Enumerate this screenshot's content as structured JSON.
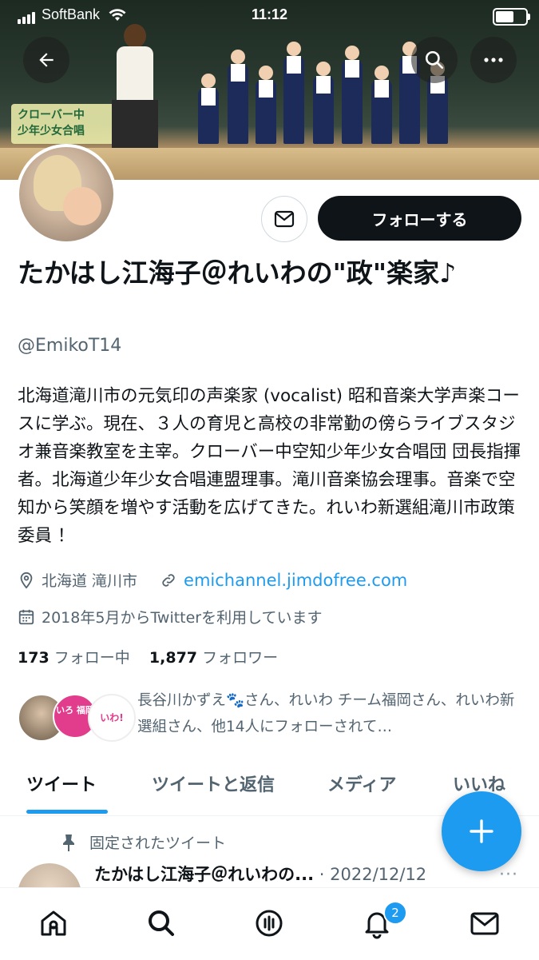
{
  "status_bar": {
    "carrier": "SoftBank",
    "time": "11:12"
  },
  "banner": {
    "sign_text": "クローバー中\n少年少女合唱"
  },
  "profile": {
    "name": "たかはし江海子＠れいわの\"政\"楽家♪",
    "handle": "@EmikoT14",
    "follow_label": "フォローする",
    "bio": "北海道滝川市の元気印の声楽家 (vocalist) 昭和音楽大学声楽コースに学ぶ。現在、３人の育児と高校の非常勤の傍らライブスタジオ兼音楽教室を主宰。クローバー中空知少年少女合唱団 団長指揮者。北海道少年少女合唱連盟理事。滝川音楽協会理事。音楽で空知から笑顔を増やす活動を広げてきた。れいわ新選組滝川市政策委員 ！",
    "location": "北海道 滝川市",
    "website": "emichannel.jimdofree.com",
    "joined": "2018年5月からTwitterを利用しています",
    "following_count": "173",
    "following_label": "フォロー中",
    "followers_count": "1,877",
    "followers_label": "フォロワー",
    "followed_by": "長谷川かずえ🐾さん、れいわ チーム福岡さん、れいわ新選組さん、他14人にフォローされて…",
    "fav_badge_texts": [
      "いろ 福岡",
      "いわ!"
    ]
  },
  "tabs": [
    {
      "label": "ツイート",
      "active": true
    },
    {
      "label": "ツイートと返信",
      "active": false
    },
    {
      "label": "メディア",
      "active": false
    },
    {
      "label": "いいね",
      "active": false
    }
  ],
  "pinned": {
    "label": "固定されたツイート",
    "author": "たかはし江海子＠れいわの...",
    "date": "· 2022/12/12",
    "more": "···"
  },
  "bottom_nav": {
    "notifications_badge": "2",
    "icons": [
      "home-icon",
      "search-icon",
      "spaces-icon",
      "bell-icon",
      "mail-icon"
    ]
  },
  "colors": {
    "accent": "#1d9bf0",
    "text": "#0f1419",
    "muted": "#536471",
    "follow_bg": "#0f1419"
  }
}
